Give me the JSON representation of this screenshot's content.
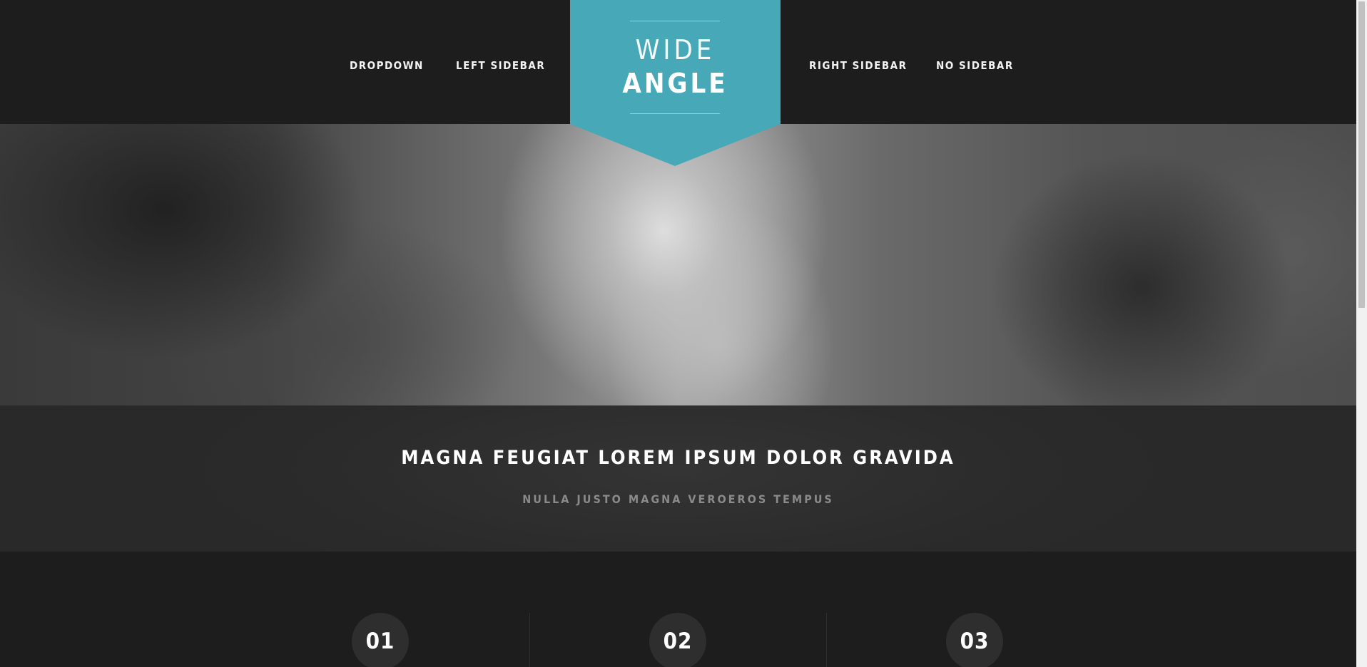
{
  "nav": {
    "left_items": [
      {
        "label": "DROPDOWN"
      },
      {
        "label": "LEFT SIDEBAR"
      }
    ],
    "right_items": [
      {
        "label": "RIGHT SIDEBAR"
      },
      {
        "label": "NO SIDEBAR"
      }
    ]
  },
  "logo": {
    "line1": "WIDE",
    "line2": "ANGLE",
    "color": "#47a8b8"
  },
  "intro": {
    "title": "MAGNA FEUGIAT LOREM IPSUM DOLOR GRAVIDA",
    "subtitle": "NULLA JUSTO MAGNA VEROEROS TEMPUS"
  },
  "features": [
    {
      "number": "01"
    },
    {
      "number": "02"
    },
    {
      "number": "03"
    }
  ],
  "colors": {
    "header_bg": "#1d1d1d",
    "intro_bg": "#2b2b2b",
    "accent": "#47a8b8",
    "circle_bg": "#2e2e2e",
    "subtitle_text": "#8a8a8a"
  }
}
